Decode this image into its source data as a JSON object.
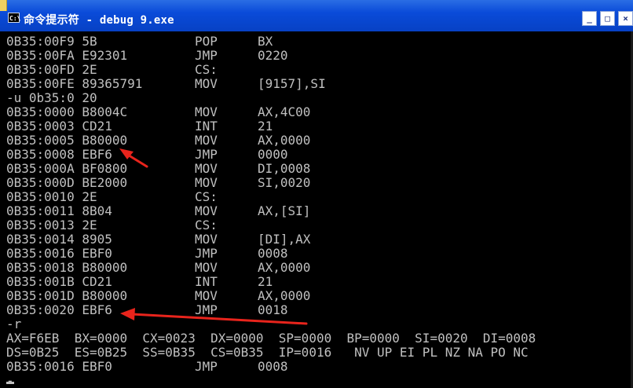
{
  "window": {
    "title": "命令提示符 - debug 9.exe",
    "icon_text": "C:\\",
    "minimize_glyph": "_",
    "maximize_glyph": "□",
    "close_glyph": "×"
  },
  "colors": {
    "titlebar": "#0a4bd9",
    "console_bg": "#000000",
    "console_text": "#c0c0c0",
    "annotation_arrow": "#e8241c"
  },
  "console": {
    "lines": [
      {
        "addr": "0B35:00F9 5B",
        "op": "POP",
        "arg": "BX"
      },
      {
        "addr": "0B35:00FA E92301",
        "op": "JMP",
        "arg": "0220"
      },
      {
        "addr": "0B35:00FD 2E",
        "op": "CS:",
        "arg": ""
      },
      {
        "addr": "0B35:00FE 89365791",
        "op": "MOV",
        "arg": "[9157],SI"
      },
      {
        "addr": "-u 0b35:0 20",
        "op": "",
        "arg": ""
      },
      {
        "addr": "0B35:0000 B8004C",
        "op": "MOV",
        "arg": "AX,4C00"
      },
      {
        "addr": "0B35:0003 CD21",
        "op": "INT",
        "arg": "21"
      },
      {
        "addr": "0B35:0005 B80000",
        "op": "MOV",
        "arg": "AX,0000"
      },
      {
        "addr": "0B35:0008 EBF6",
        "op": "JMP",
        "arg": "0000"
      },
      {
        "addr": "0B35:000A BF0800",
        "op": "MOV",
        "arg": "DI,0008"
      },
      {
        "addr": "0B35:000D BE2000",
        "op": "MOV",
        "arg": "SI,0020"
      },
      {
        "addr": "0B35:0010 2E",
        "op": "CS:",
        "arg": ""
      },
      {
        "addr": "0B35:0011 8B04",
        "op": "MOV",
        "arg": "AX,[SI]"
      },
      {
        "addr": "0B35:0013 2E",
        "op": "CS:",
        "arg": ""
      },
      {
        "addr": "0B35:0014 8905",
        "op": "MOV",
        "arg": "[DI],AX"
      },
      {
        "addr": "0B35:0016 EBF0",
        "op": "JMP",
        "arg": "0008"
      },
      {
        "addr": "0B35:0018 B80000",
        "op": "MOV",
        "arg": "AX,0000"
      },
      {
        "addr": "0B35:001B CD21",
        "op": "INT",
        "arg": "21"
      },
      {
        "addr": "0B35:001D B80000",
        "op": "MOV",
        "arg": "AX,0000"
      },
      {
        "addr": "0B35:0020 EBF6",
        "op": "JMP",
        "arg": "0018"
      },
      {
        "addr": "-r",
        "op": "",
        "arg": ""
      },
      {
        "addr": "AX=F6EB  BX=0000  CX=0023  DX=0000  SP=0000  BP=0000  SI=0020  DI=0008",
        "op": "",
        "arg": ""
      },
      {
        "addr": "DS=0B25  ES=0B25  SS=0B35  CS=0B35  IP=0016   NV UP EI PL NZ NA PO NC",
        "op": "",
        "arg": ""
      },
      {
        "addr": "0B35:0016 EBF0",
        "op": "JMP",
        "arg": "0008"
      },
      {
        "addr": "-",
        "op": "",
        "arg": ""
      }
    ]
  }
}
